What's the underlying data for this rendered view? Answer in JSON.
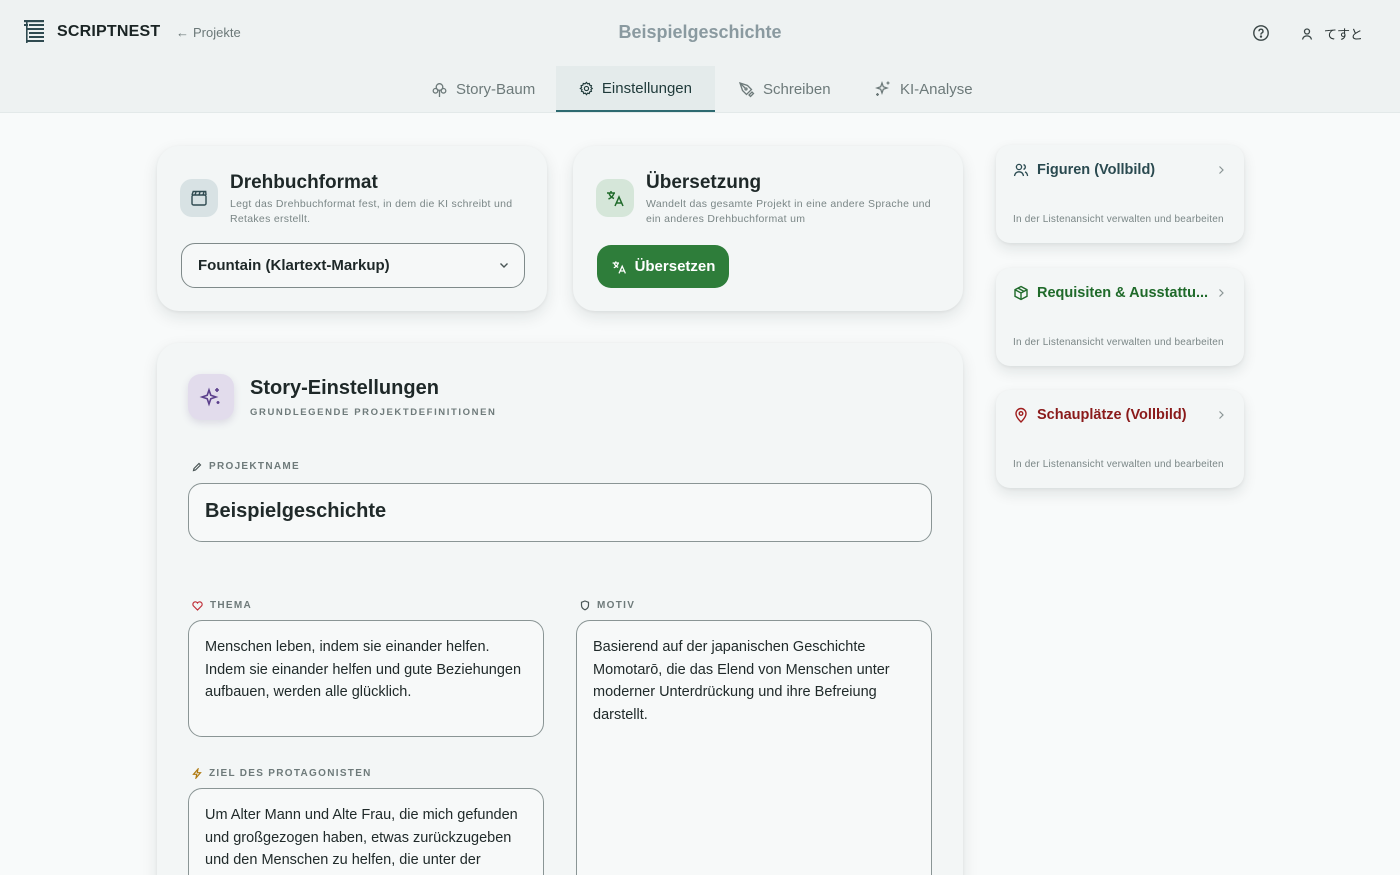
{
  "app": {
    "name": "SCRIPTNEST",
    "back_label": "Projekte",
    "document_title": "Beispielgeschichte",
    "user_name": "てすと"
  },
  "tabs": [
    {
      "label": "Story-Baum",
      "icon": "tree-icon"
    },
    {
      "label": "Einstellungen",
      "icon": "gear-icon",
      "active": true
    },
    {
      "label": "Schreiben",
      "icon": "pen-icon"
    },
    {
      "label": "KI-Analyse",
      "icon": "sparkles-icon"
    }
  ],
  "format_card": {
    "title": "Drehbuchformat",
    "description": "Legt das Drehbuchformat fest, in dem die KI schreibt und Retakes erstellt.",
    "selected": "Fountain (Klartext-Markup)"
  },
  "translation_card": {
    "title": "Übersetzung",
    "description": "Wandelt das gesamte Projekt in eine andere Sprache und ein anderes Drehbuchformat um",
    "button_label": "Übersetzen"
  },
  "story_settings": {
    "title": "Story-Einstellungen",
    "subtitle": "GRUNDLEGENDE PROJEKTDEFINITIONEN",
    "project_name_label": "PROJEKTNAME",
    "project_name": "Beispielgeschichte",
    "theme_label": "THEMA",
    "theme": "Menschen leben, indem sie einander helfen. Indem sie einander helfen und gute Beziehungen aufbauen, werden alle glücklich.",
    "motif_label": "MOTIV",
    "motif": "Basierend auf der japanischen Geschichte Momotarō, die das Elend von Menschen unter moderner Unterdrückung und ihre Befreiung darstellt.",
    "goal_label": "ZIEL DES PROTAGONISTEN",
    "goal": "Um Alter Mann und Alte Frau, die mich gefunden und großgezogen haben, etwas zurückzugeben und den Menschen zu helfen, die unter der"
  },
  "side_cards": [
    {
      "title": "Figuren (Vollbild)",
      "description": "In der Listenansicht verwalten und bearbeiten",
      "color": "#2a4a50",
      "icon": "users-icon"
    },
    {
      "title": "Requisiten & Ausstattu...",
      "description": "In der Listenansicht verwalten und bearbeiten",
      "color": "#1f6a2a",
      "icon": "box-icon"
    },
    {
      "title": "Schauplätze (Vollbild)",
      "description": "In der Listenansicht verwalten und bearbeiten",
      "color": "#8a1a1a",
      "icon": "map-pin-icon"
    }
  ]
}
